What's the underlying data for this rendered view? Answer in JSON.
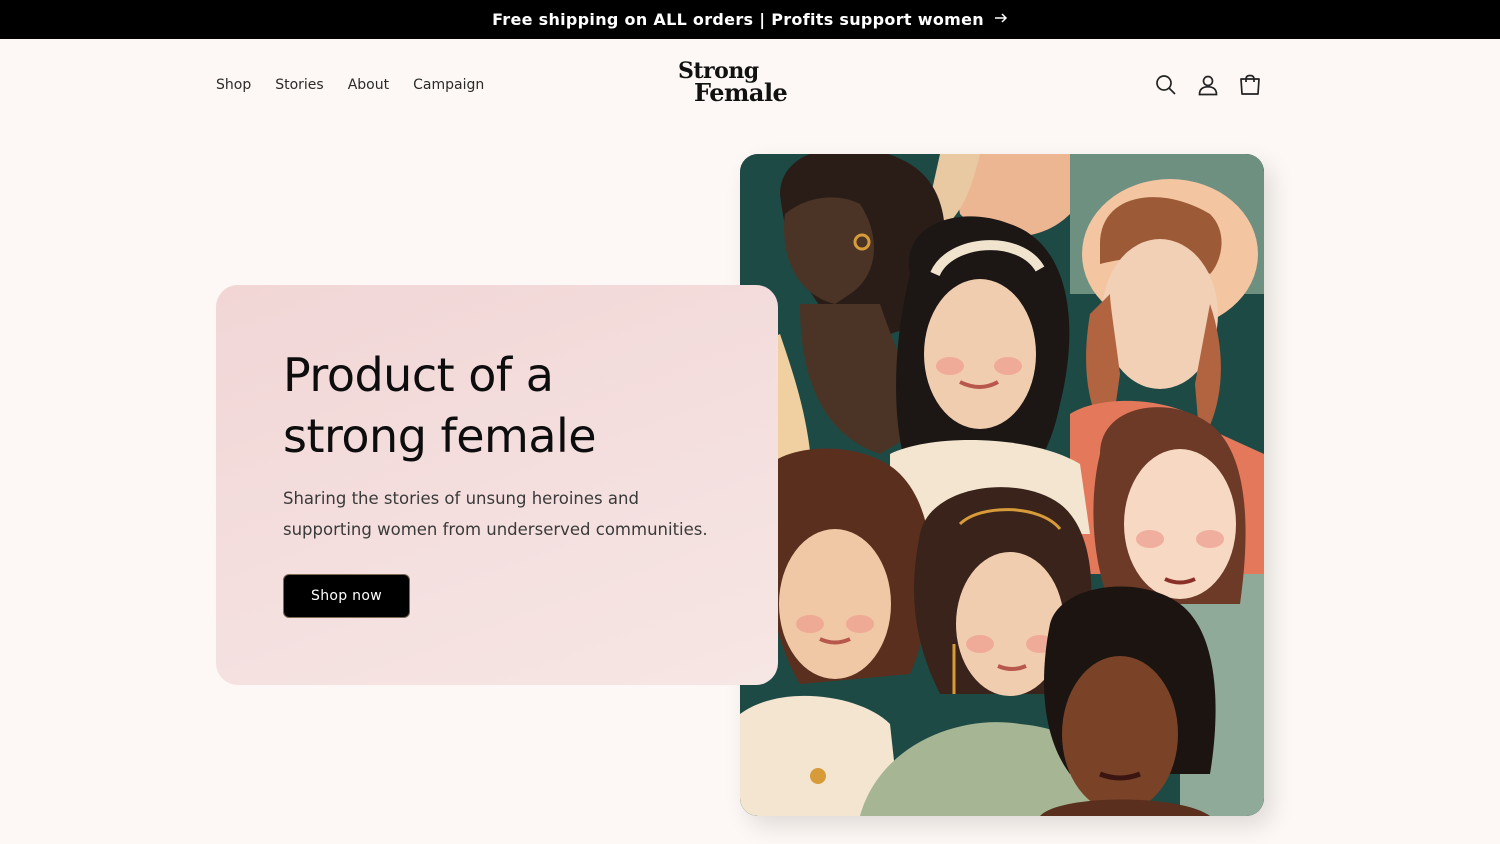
{
  "announcement": {
    "text": "Free shipping on ALL orders | Profits support women",
    "arrow_icon": "arrow-right-icon"
  },
  "nav": {
    "items": [
      {
        "label": "Shop"
      },
      {
        "label": "Stories"
      },
      {
        "label": "About"
      },
      {
        "label": "Campaign"
      }
    ]
  },
  "logo": {
    "line1": "Strong",
    "line2": "Female"
  },
  "header_icons": [
    "search-icon",
    "account-icon",
    "cart-icon"
  ],
  "hero": {
    "title": "Product of a strong female",
    "subtitle": "Sharing the stories of unsung heroines and supporting women from underserved communities.",
    "cta_label": "Shop now"
  },
  "colors": {
    "background": "#fdf8f5",
    "announcement_bg": "#000000",
    "card_bg": "#f2d6d6",
    "button_bg": "#000000",
    "illustration_bg": "#1e4a45"
  }
}
